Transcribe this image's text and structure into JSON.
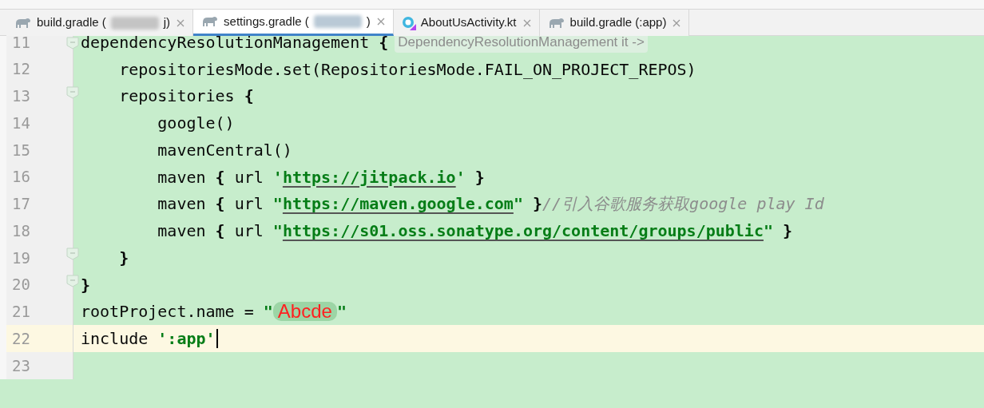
{
  "tabs": [
    {
      "kind": "gradle",
      "label_start": "build.gradle (",
      "label_end": "j)",
      "redacted": true,
      "selected": false
    },
    {
      "kind": "gradle",
      "label_start": "settings.gradle (",
      "label_end": ")",
      "redacted": true,
      "selected": true
    },
    {
      "kind": "kotlin",
      "label_start": "AboutUsActivity.kt",
      "redacted": false,
      "selected": false
    },
    {
      "kind": "gradle",
      "label_start": "build.gradle (:app)",
      "redacted": false,
      "selected": false
    }
  ],
  "editor": {
    "lines": [
      {
        "number": "11",
        "current": false,
        "fold": true,
        "segments": [
          {
            "kind": "plain",
            "text": "dependencyResolutionManagement "
          },
          {
            "kind": "brace",
            "text": "{"
          },
          {
            "kind": "hint",
            "text": "DependencyResolutionManagement it ->"
          }
        ]
      },
      {
        "number": "12",
        "current": false,
        "fold": false,
        "segments": [
          {
            "kind": "plain",
            "text": "    repositoriesMode.set(RepositoriesMode.FAIL_ON_PROJECT_REPOS)"
          }
        ]
      },
      {
        "number": "13",
        "current": false,
        "fold": true,
        "segments": [
          {
            "kind": "plain",
            "text": "    repositories "
          },
          {
            "kind": "brace",
            "text": "{"
          }
        ]
      },
      {
        "number": "14",
        "current": false,
        "fold": false,
        "segments": [
          {
            "kind": "plain",
            "text": "        google()"
          }
        ]
      },
      {
        "number": "15",
        "current": false,
        "fold": false,
        "segments": [
          {
            "kind": "plain",
            "text": "        mavenCentral()"
          }
        ]
      },
      {
        "number": "16",
        "current": false,
        "fold": false,
        "segments": [
          {
            "kind": "plain",
            "text": "        maven "
          },
          {
            "kind": "brace",
            "text": "{"
          },
          {
            "kind": "plain",
            "text": " url "
          },
          {
            "kind": "string",
            "text": "'"
          },
          {
            "kind": "url",
            "text": "https://jitpack.io"
          },
          {
            "kind": "string",
            "text": "'"
          },
          {
            "kind": "brace",
            "text": " }"
          }
        ]
      },
      {
        "number": "17",
        "current": false,
        "fold": false,
        "segments": [
          {
            "kind": "plain",
            "text": "        maven "
          },
          {
            "kind": "brace",
            "text": "{"
          },
          {
            "kind": "plain",
            "text": " url "
          },
          {
            "kind": "string",
            "text": "\""
          },
          {
            "kind": "url",
            "text": "https://maven.google.com"
          },
          {
            "kind": "string",
            "text": "\""
          },
          {
            "kind": "brace",
            "text": " }"
          },
          {
            "kind": "comment",
            "text": "//引入谷歌服务获取google play Id"
          }
        ]
      },
      {
        "number": "18",
        "current": false,
        "fold": false,
        "segments": [
          {
            "kind": "plain",
            "text": "        maven "
          },
          {
            "kind": "brace",
            "text": "{"
          },
          {
            "kind": "plain",
            "text": " url "
          },
          {
            "kind": "string",
            "text": "\""
          },
          {
            "kind": "url",
            "text": "https://s01.oss.sonatype.org/content/groups/public"
          },
          {
            "kind": "string",
            "text": "\""
          },
          {
            "kind": "brace",
            "text": " }"
          }
        ]
      },
      {
        "number": "19",
        "current": false,
        "fold": true,
        "segments": [
          {
            "kind": "brace",
            "text": "    }"
          }
        ]
      },
      {
        "number": "20",
        "current": false,
        "fold": true,
        "segments": [
          {
            "kind": "brace",
            "text": "}"
          }
        ]
      },
      {
        "number": "21",
        "current": false,
        "fold": false,
        "segments": [
          {
            "kind": "plain",
            "text": "rootProject.name = "
          },
          {
            "kind": "string",
            "text": "\""
          },
          {
            "kind": "annotation",
            "text": "Abcde"
          },
          {
            "kind": "string",
            "text": "\""
          }
        ]
      },
      {
        "number": "22",
        "current": true,
        "fold": false,
        "segments": [
          {
            "kind": "plain",
            "text": "include "
          },
          {
            "kind": "string",
            "text": "':app'"
          },
          {
            "kind": "caret"
          }
        ]
      },
      {
        "number": "23",
        "current": false,
        "fold": false
      }
    ]
  }
}
